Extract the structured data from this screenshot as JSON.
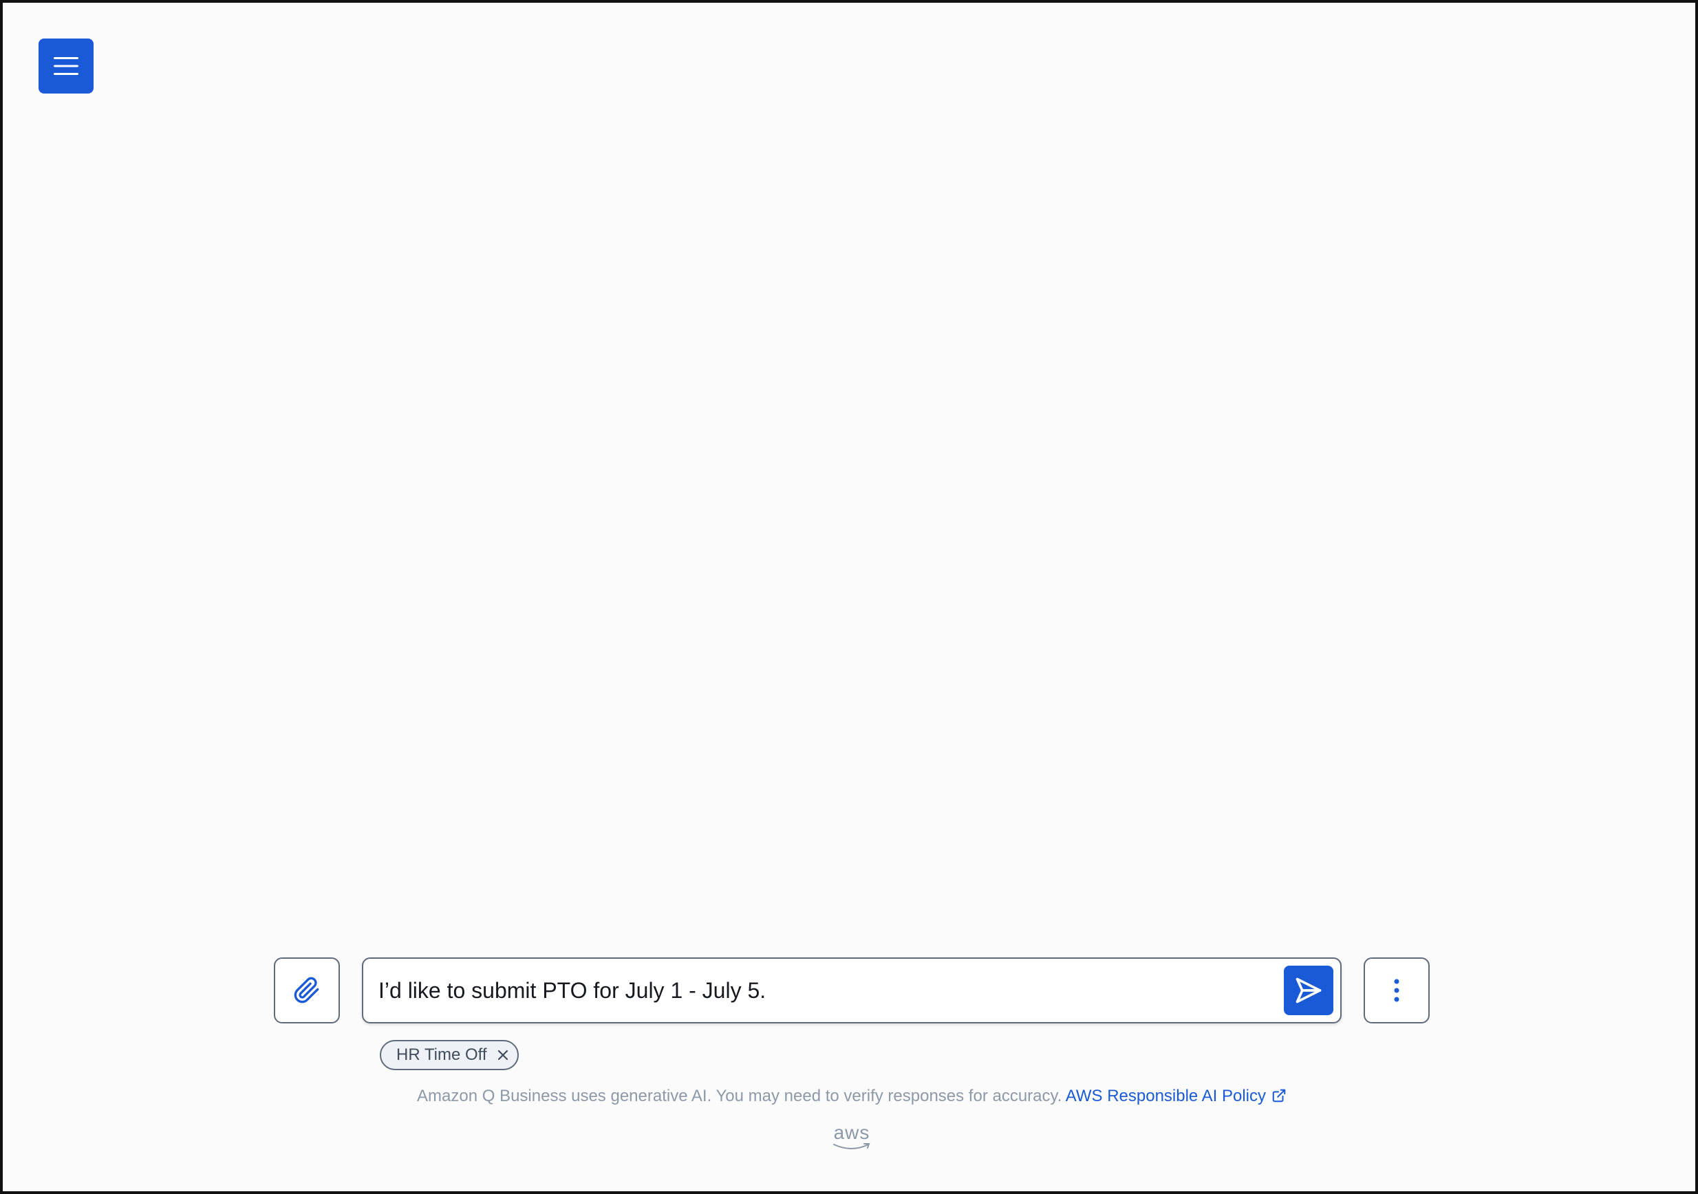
{
  "header": {
    "menu_icon": "hamburger-menu-icon"
  },
  "composer": {
    "attach_icon": "paperclip-icon",
    "input_value": "I’d like to submit PTO for July 1 - July 5.",
    "send_icon": "paper-plane-send-icon",
    "more_icon": "vertical-ellipsis-icon"
  },
  "plugin_chip": {
    "label": "HR Time Off",
    "close_icon": "close-icon"
  },
  "footer": {
    "disclaimer_text": "Amazon Q Business uses generative AI. You may need to verify responses for accuracy.",
    "policy_link_label": "AWS Responsible AI Policy",
    "external_link_icon": "external-link-icon",
    "logo_text": "aws"
  },
  "colors": {
    "accent": "#1a5ad7",
    "border": "#5f6b7a",
    "muted_text": "#8d99a8",
    "background": "#fbfbfc"
  }
}
